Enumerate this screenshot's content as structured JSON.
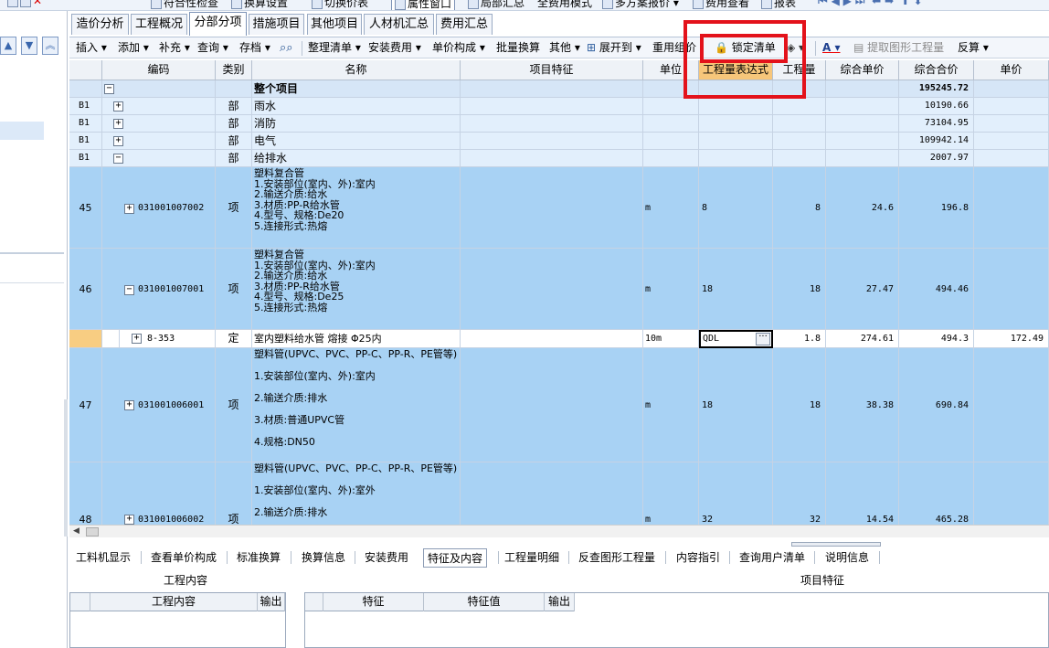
{
  "top_toolbar": [
    "符合性检查",
    "换算设置",
    "切换价表",
    "属性窗口",
    "局部汇总",
    "全费用模式",
    "多方案报价",
    "费用查看",
    "报表"
  ],
  "tabs": [
    "造价分析",
    "工程概况",
    "分部分项",
    "措施项目",
    "其他项目",
    "人材机汇总",
    "费用汇总"
  ],
  "active_tab": "分部分项",
  "toolbar": {
    "insert": "插入",
    "add": "添加",
    "supplement": "补充",
    "query": "查询",
    "save": "存档",
    "organize": "整理清单",
    "install_fee": "安装费用",
    "unit_price": "单价构成",
    "batch_convert": "批量换算",
    "other": "其他",
    "expand_to": "展开到",
    "reuse": "重用组价",
    "lock_list": "锁定清单",
    "extract": "提取图形工程量",
    "reverse": "反算"
  },
  "columns": [
    "编码",
    "类别",
    "名称",
    "项目特征",
    "单位",
    "工程量表达式",
    "工程量",
    "综合单价",
    "综合合价",
    "单价"
  ],
  "total_row": {
    "name": "整个项目",
    "total": "195245.72"
  },
  "sections": [
    {
      "no": "B1",
      "type": "部",
      "name": "雨水",
      "total": "10190.66"
    },
    {
      "no": "B1",
      "type": "部",
      "name": "消防",
      "total": "73104.95"
    },
    {
      "no": "B1",
      "type": "部",
      "name": "电气",
      "total": "109942.14"
    },
    {
      "no": "B1",
      "type": "部",
      "name": "给排水",
      "total": "2007.97"
    }
  ],
  "items": [
    {
      "no": "45",
      "code": "031001007002",
      "type": "项",
      "name": "塑料复合管\n1.安装部位(室内、外):室内\n2.输送介质:给水\n3.材质:PP-R给水管\n4.型号、规格:De20\n5.连接形式:热熔",
      "unit": "m",
      "expr": "8",
      "qty": "8",
      "unit_price": "24.6",
      "total": "196.8"
    },
    {
      "no": "46",
      "code": "031001007001",
      "type": "项",
      "name": "塑料复合管\n1.安装部位(室内、外):室内\n2.输送介质:给水\n3.材质:PP-R给水管\n4.型号、规格:De25\n5.连接形式:热熔",
      "unit": "m",
      "expr": "18",
      "qty": "18",
      "unit_price": "27.47",
      "total": "494.46"
    },
    {
      "no": "",
      "code": "8-353",
      "type": "定",
      "name": "室内塑料给水管 熔接 Φ25内",
      "unit": "10m",
      "expr": "QDL",
      "qty": "1.8",
      "unit_price": "274.61",
      "total": "494.3",
      "price": "172.49"
    },
    {
      "no": "47",
      "code": "031001006001",
      "type": "项",
      "name": "塑料管(UPVC、PVC、PP-C、PP-R、PE管等)\n\n1.安装部位(室内、外):室内\n\n2.输送介质:排水\n\n3.材质:普通UPVC管\n\n4.规格:DN50",
      "unit": "m",
      "expr": "18",
      "qty": "18",
      "unit_price": "38.38",
      "total": "690.84"
    },
    {
      "no": "48",
      "code": "031001006002",
      "type": "项",
      "name": "塑料管(UPVC、PVC、PP-C、PP-R、PE管等)\n\n1.安装部位(室内、外):室外\n\n2.输送介质:排水",
      "unit": "m",
      "expr": "32",
      "qty": "32",
      "unit_price": "14.54",
      "total": "465.28"
    }
  ],
  "bottom_tabs": [
    "工料机显示",
    "查看单价构成",
    "标准换算",
    "换算信息",
    "安装费用",
    "特征及内容",
    "工程量明细",
    "反查图形工程量",
    "内容指引",
    "查询用户清单",
    "说明信息"
  ],
  "active_bottom_tab": "特征及内容",
  "work_content": {
    "title": "工程内容",
    "col1": "工程内容",
    "col2": "输出"
  },
  "features": {
    "title": "项目特征",
    "col1": "特征",
    "col2": "特征值",
    "col3": "输出"
  },
  "colors": {
    "item_row": "#a8d2f4",
    "section_row": "#e2effc",
    "header_highlight": "#f7c67a",
    "annotation_red": "#e3121b"
  }
}
